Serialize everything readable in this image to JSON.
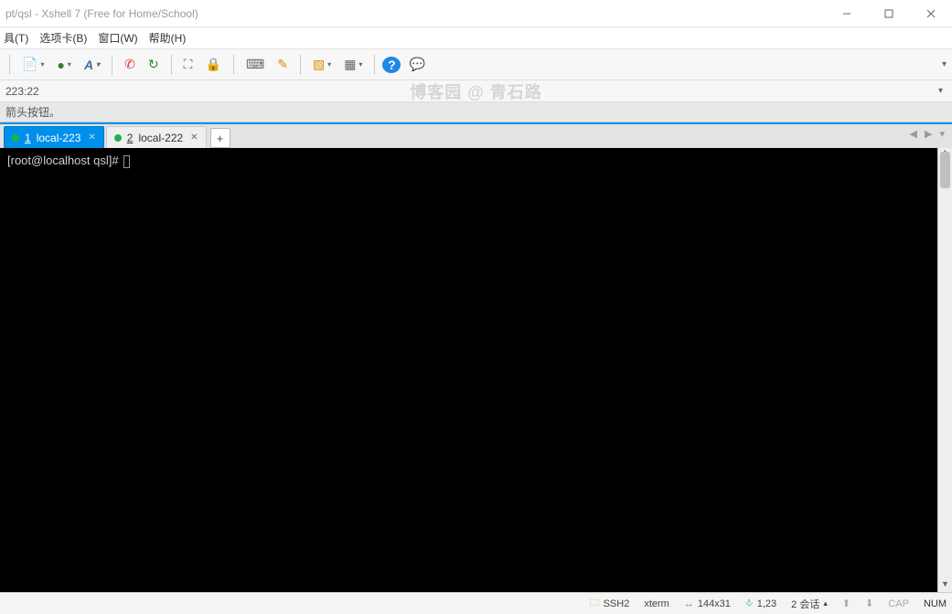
{
  "title": "pt/qsl - Xshell 7 (Free for Home/School)",
  "menu": {
    "tools": "具(T)",
    "tabs": "选项卡(B)",
    "window": "窗口(W)",
    "help": "帮助(H)"
  },
  "address_value": "223:22",
  "watermark": "博客园 @ 青石路",
  "hint": "箭头按钮。",
  "tabs": [
    {
      "index": "1",
      "label": "local-223",
      "active": true
    },
    {
      "index": "2",
      "label": "local-222",
      "active": false
    }
  ],
  "terminal": {
    "prompt": "[root@localhost qsl]# "
  },
  "status": {
    "protocol": "SSH2",
    "term_type": "xterm",
    "size": "144x31",
    "cursor": "1,23",
    "sessions_label": "2 会话",
    "cap": "CAP",
    "num": "NUM"
  },
  "icons": {
    "folder": "🗂",
    "globe": "🌐",
    "font": "A",
    "phone": "☎",
    "refresh": "⟳",
    "expand": "⛶",
    "lock": "🔒",
    "keyboard": "⌨",
    "brush": "✎",
    "newtab": "➕",
    "grid": "▦",
    "help": "?",
    "bubble": "💬"
  }
}
